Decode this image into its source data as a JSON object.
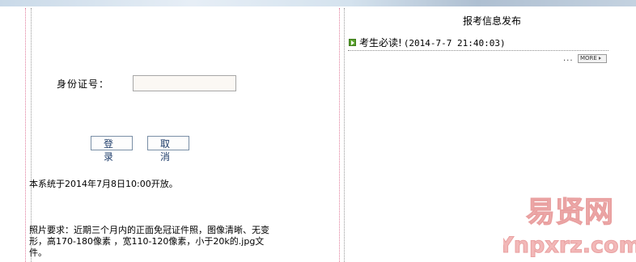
{
  "login": {
    "id_label": "身份证号：",
    "id_value": "",
    "login_button": "登录",
    "cancel_button": "取消"
  },
  "notice": "本系统于2014年7月8日10:00开放。",
  "photo_requirements": "照片要求：近期三个月内的正面免冠证件照，图像清晰、无变形，高170-180像素 ，宽110-120像素，小于20k的.jpg文件。",
  "news_panel": {
    "title": "报考信息发布",
    "items": [
      {
        "title": "考生必读!",
        "date": "(2014-7-7 21:40:03)"
      }
    ],
    "more_dots": "...",
    "more_label": "MORE"
  },
  "watermark": {
    "text_cn": "易贤网",
    "text_url": "Ynpxrz.com",
    "color": "#f2b8b8"
  },
  "colors": {
    "divider_pink": "#e07a9a",
    "button_text": "#1e3c6a",
    "bullet_green": "#5aa22e"
  }
}
